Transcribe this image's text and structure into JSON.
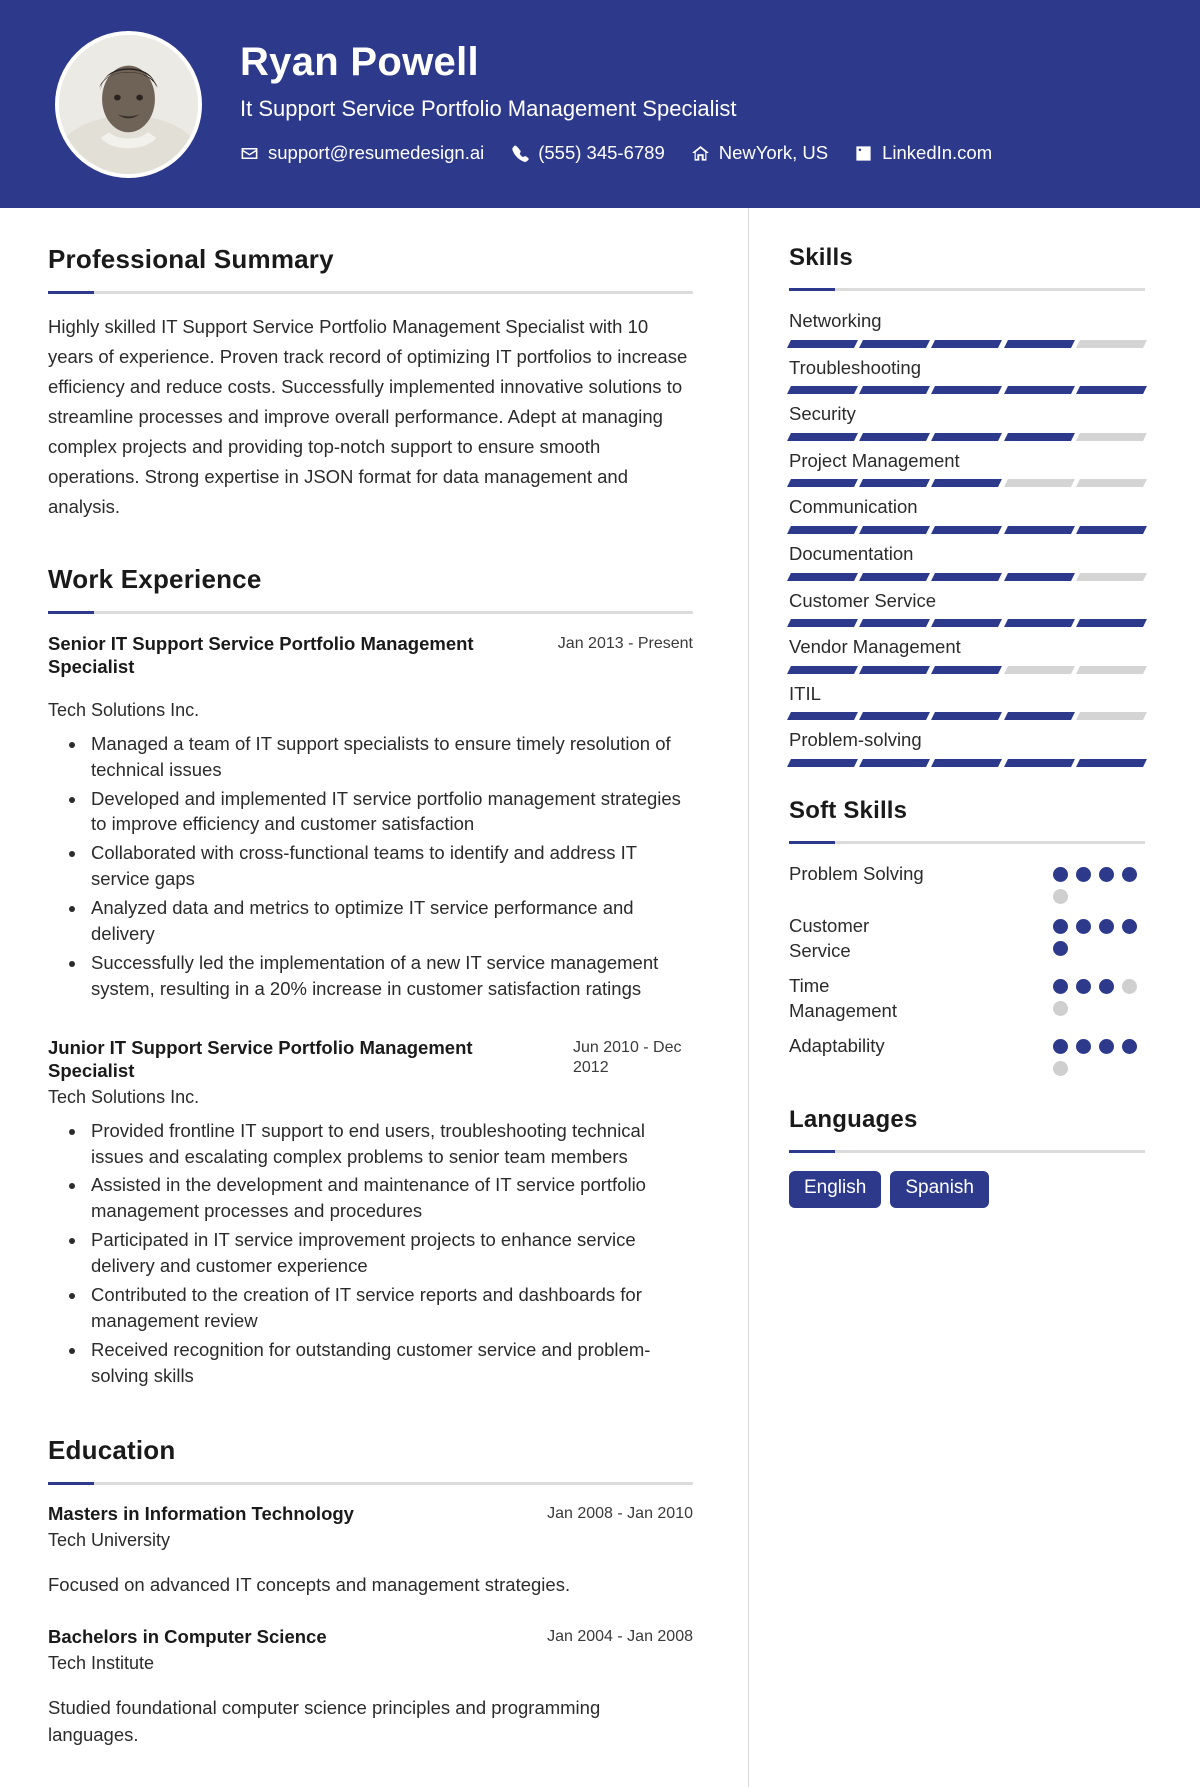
{
  "header": {
    "name": "Ryan Powell",
    "job_title": "It Support Service Portfolio Management Specialist",
    "avatar_alt": "profile-photo",
    "background_color": "#2d3a8c",
    "contacts": [
      {
        "icon": "envelope-icon",
        "text": "support@resumedesign.ai"
      },
      {
        "icon": "phone-icon",
        "text": "(555) 345-6789"
      },
      {
        "icon": "home-icon",
        "text": "NewYork, US"
      },
      {
        "icon": "linkedin-icon",
        "text": "LinkedIn.com"
      }
    ]
  },
  "summary": {
    "title": "Professional Summary",
    "text": "Highly skilled IT Support Service Portfolio Management Specialist with 10 years of experience. Proven track record of optimizing IT portfolios to increase efficiency and reduce costs. Successfully implemented innovative solutions to streamline processes and improve overall performance. Adept at managing complex projects and providing top-notch support to ensure smooth operations. Strong expertise in JSON format for data management and analysis."
  },
  "work": {
    "title": "Work Experience",
    "jobs": [
      {
        "role": "Senior IT Support Service Portfolio Management Specialist",
        "dates": "Jan 2013 - Present",
        "company": "Tech Solutions Inc.",
        "bullets": [
          "Managed a team of IT support specialists to ensure timely resolution of technical issues",
          "Developed and implemented IT service portfolio management strategies to improve efficiency and customer satisfaction",
          "Collaborated with cross-functional teams to identify and address IT service gaps",
          "Analyzed data and metrics to optimize IT service performance and delivery",
          "Successfully led the implementation of a new IT service management system, resulting in a 20% increase in customer satisfaction ratings"
        ]
      },
      {
        "role": "Junior IT Support Service Portfolio Management Specialist",
        "dates": "Jun 2010 - Dec 2012",
        "company": "Tech Solutions Inc.",
        "bullets": [
          "Provided frontline IT support to end users, troubleshooting technical issues and escalating complex problems to senior team members",
          "Assisted in the development and maintenance of IT service portfolio management processes and procedures",
          "Participated in IT service improvement projects to enhance service delivery and customer experience",
          "Contributed to the creation of IT service reports and dashboards for management review",
          "Received recognition for outstanding customer service and problem-solving skills"
        ]
      }
    ]
  },
  "education": {
    "title": "Education",
    "items": [
      {
        "degree": "Masters in Information Technology",
        "dates": "Jan 2008 - Jan 2010",
        "school": "Tech University",
        "description": "Focused on advanced IT concepts and management strategies."
      },
      {
        "degree": "Bachelors in Computer Science",
        "dates": "Jan 2004 - Jan 2008",
        "school": "Tech Institute",
        "description": "Studied foundational computer science principles and programming languages."
      }
    ]
  },
  "skills": {
    "title": "Skills",
    "max_segments": 5,
    "items": [
      {
        "name": "Networking",
        "level": 4
      },
      {
        "name": "Troubleshooting",
        "level": 5
      },
      {
        "name": "Security",
        "level": 4
      },
      {
        "name": "Project Management",
        "level": 3
      },
      {
        "name": "Communication",
        "level": 5
      },
      {
        "name": "Documentation",
        "level": 4
      },
      {
        "name": "Customer Service",
        "level": 5
      },
      {
        "name": "Vendor Management",
        "level": 3
      },
      {
        "name": "ITIL",
        "level": 4
      },
      {
        "name": "Problem-solving",
        "level": 5
      }
    ]
  },
  "soft_skills": {
    "title": "Soft Skills",
    "max_dots": 5,
    "items": [
      {
        "name": "Problem Solving",
        "level": 4
      },
      {
        "name": "Customer Service",
        "level": 5
      },
      {
        "name": "Time Management",
        "level": 3
      },
      {
        "name": "Adaptability",
        "level": 4
      }
    ]
  },
  "languages": {
    "title": "Languages",
    "items": [
      "English",
      "Spanish"
    ]
  },
  "colors": {
    "accent": "#2d3a8c",
    "track": "#d4d4d4",
    "rule": "#dcdcdc"
  }
}
